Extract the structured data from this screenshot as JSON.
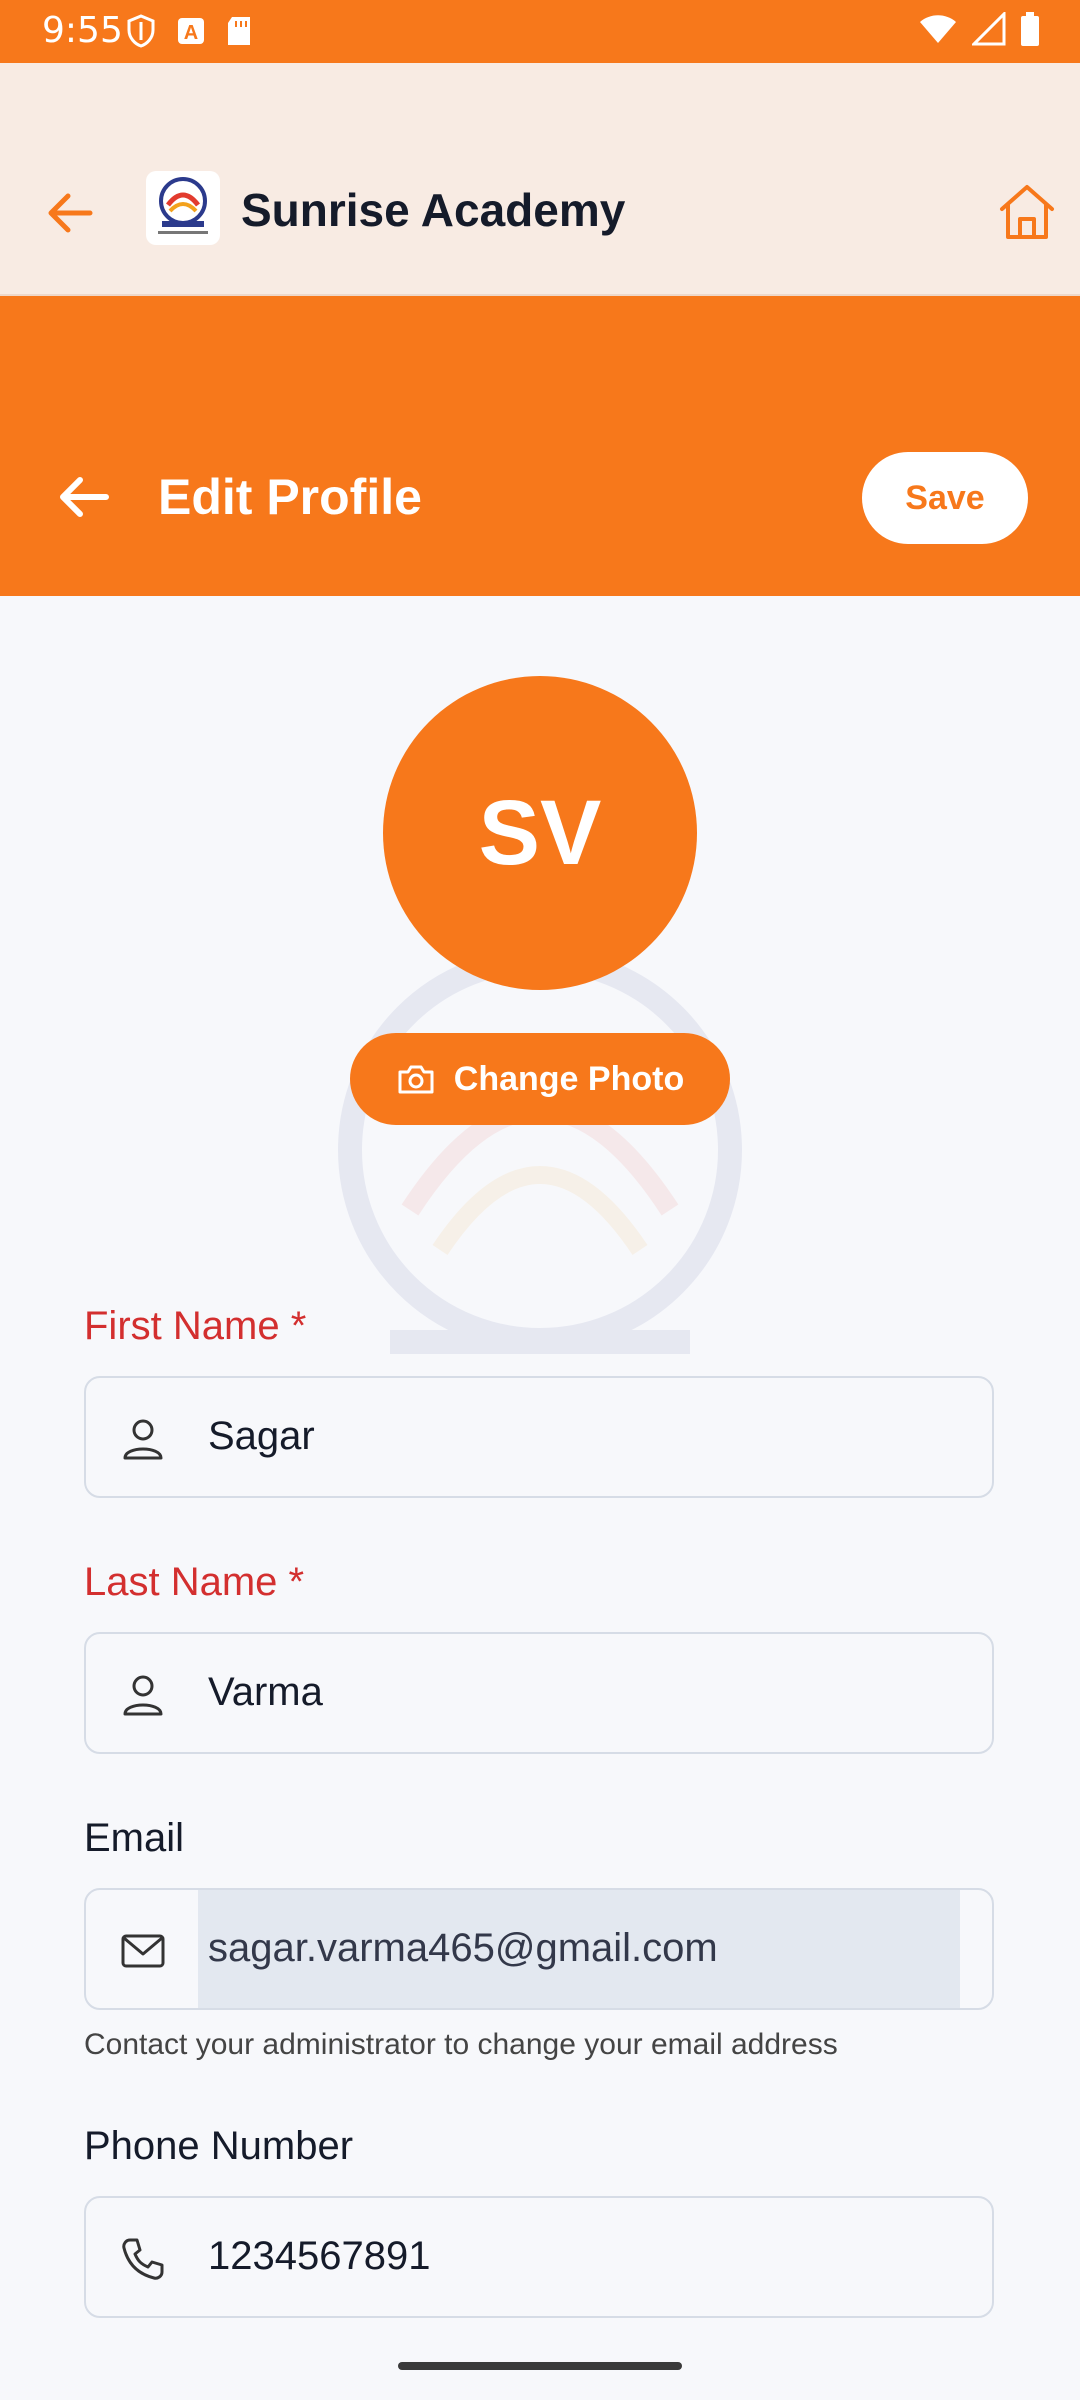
{
  "status_bar": {
    "time": "9:55"
  },
  "app_bar": {
    "title": "Sunrise Academy"
  },
  "header": {
    "title": "Edit Profile",
    "save_label": "Save"
  },
  "profile": {
    "initials": "SV",
    "change_photo_label": "Change Photo"
  },
  "form": {
    "first_name": {
      "label": "First Name",
      "required_mark": "*",
      "value": "Sagar"
    },
    "last_name": {
      "label": "Last Name",
      "required_mark": "*",
      "value": "Varma"
    },
    "email": {
      "label": "Email",
      "value": "sagar.varma465@gmail.com",
      "helper": "Contact your administrator to change your email address"
    },
    "phone": {
      "label": "Phone Number",
      "value": "1234567891"
    }
  },
  "colors": {
    "accent": "#F7781B",
    "required": "#D32F2F",
    "app_bar_bg": "#F8EBE3"
  }
}
